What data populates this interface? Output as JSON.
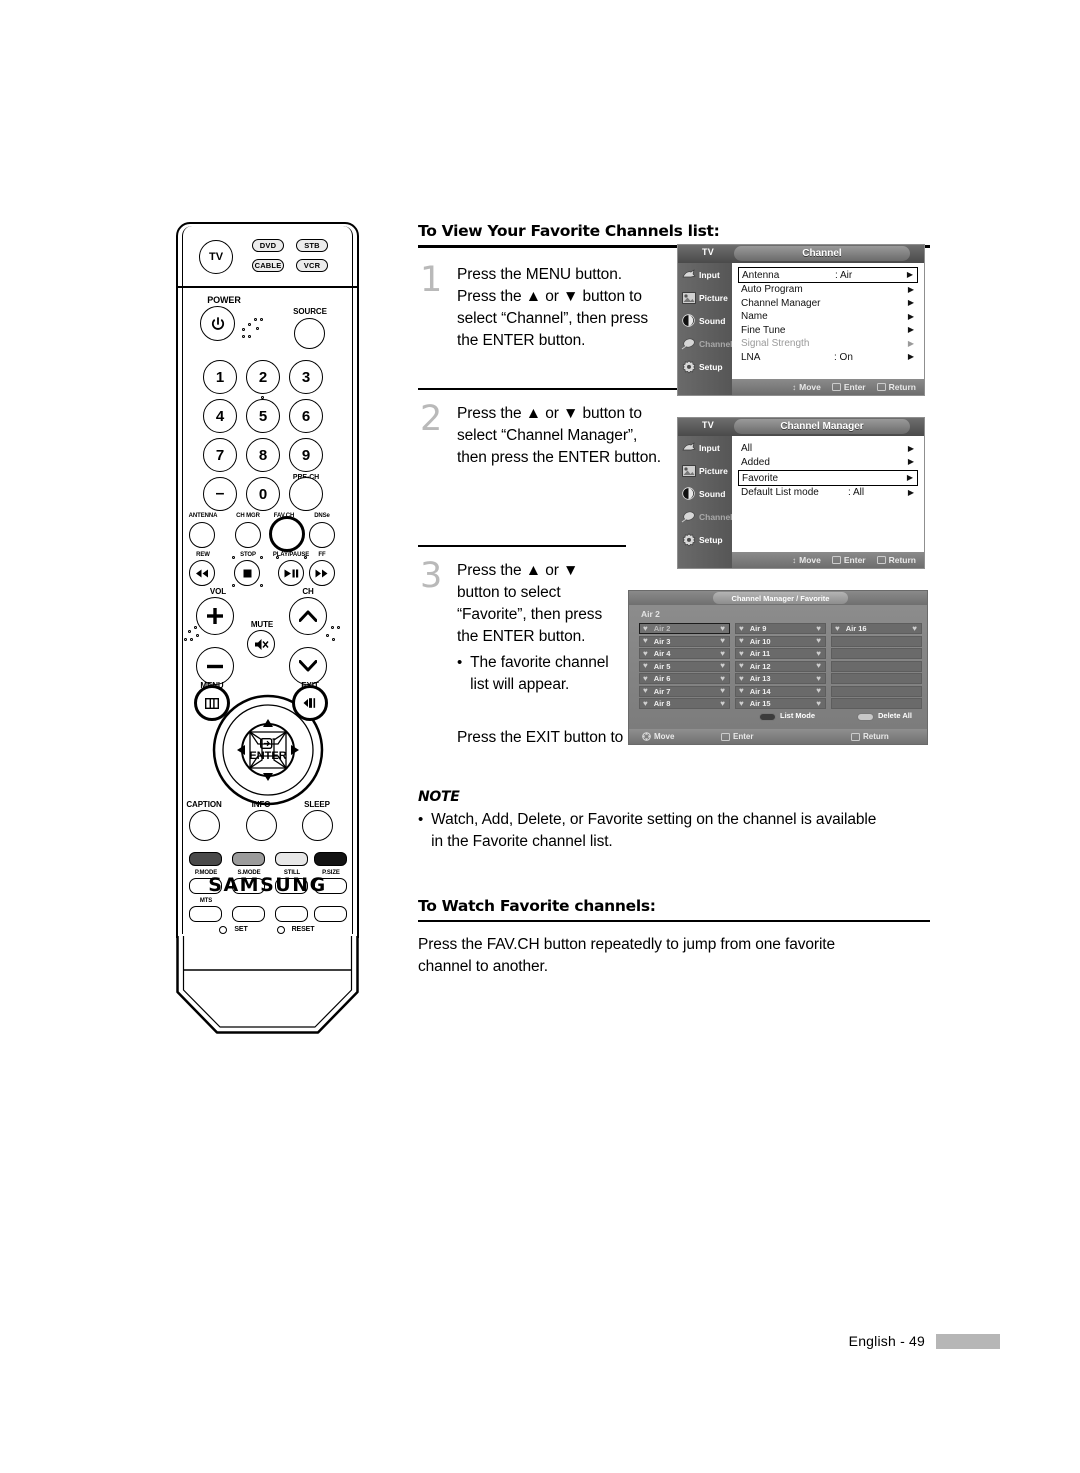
{
  "document": {
    "page_label": "English - 49"
  },
  "sections": {
    "heading1": "To View Your Favorite Channels list:",
    "heading2": "To Watch Favorite channels:",
    "note_label": "NOTE",
    "note_text": "Watch, Add, Delete, or Favorite setting on the channel is available in the Favorite channel list.",
    "exit_text": "Press the EXIT button to exit.",
    "watch_text": "Press the FAV.CH button repeatedly to jump from one favorite channel to another."
  },
  "steps": [
    {
      "number": "1",
      "lines": [
        "Press the MENU button.",
        "Press the ▲ or ▼ button to",
        "select “Channel”, then press",
        "the ENTER button."
      ]
    },
    {
      "number": "2",
      "lines": [
        "Press the ▲ or ▼ button to",
        "select “Channel Manager”,",
        "then press the ENTER button."
      ]
    },
    {
      "number": "3",
      "lines": [
        "Press the ▲ or ▼",
        "button to select",
        "“Favorite”, then press",
        "the ENTER button."
      ],
      "bullet": [
        "The favorite channel",
        "list will appear."
      ]
    }
  ],
  "osd_menu_1": {
    "tv_label": "TV",
    "title": "Channel",
    "side_items": [
      {
        "label": "Input",
        "icon": "input-icon",
        "dim": false
      },
      {
        "label": "Picture",
        "icon": "picture-icon",
        "dim": false
      },
      {
        "label": "Sound",
        "icon": "sound-icon",
        "dim": false
      },
      {
        "label": "Channel",
        "icon": "channel-icon",
        "dim": true
      },
      {
        "label": "Setup",
        "icon": "setup-icon",
        "dim": false
      }
    ],
    "rows": [
      {
        "label": "Antenna",
        "value": ": Air",
        "selected": true,
        "dim": false
      },
      {
        "label": "Auto Program",
        "value": "",
        "selected": false,
        "dim": false
      },
      {
        "label": "Channel Manager",
        "value": "",
        "selected": false,
        "dim": false
      },
      {
        "label": "Name",
        "value": "",
        "selected": false,
        "dim": false
      },
      {
        "label": "Fine Tune",
        "value": "",
        "selected": false,
        "dim": false
      },
      {
        "label": "Signal Strength",
        "value": "",
        "selected": false,
        "dim": true
      },
      {
        "label": "LNA",
        "value": ": On",
        "selected": false,
        "dim": false
      }
    ],
    "footer": {
      "move": "Move",
      "enter": "Enter",
      "return": "Return"
    }
  },
  "osd_menu_2": {
    "tv_label": "TV",
    "title": "Channel Manager",
    "side_items": [
      {
        "label": "Input",
        "icon": "input-icon",
        "dim": false
      },
      {
        "label": "Picture",
        "icon": "picture-icon",
        "dim": false
      },
      {
        "label": "Sound",
        "icon": "sound-icon",
        "dim": false
      },
      {
        "label": "Channel",
        "icon": "channel-icon",
        "dim": true
      },
      {
        "label": "Setup",
        "icon": "setup-icon",
        "dim": false
      }
    ],
    "rows": [
      {
        "label": "All",
        "value": "",
        "selected": false,
        "dim": false
      },
      {
        "label": "Added",
        "value": "",
        "selected": false,
        "dim": false
      },
      {
        "label": "Favorite",
        "value": "",
        "selected": true,
        "dim": false
      },
      {
        "label": "Default List mode",
        "value": ": All",
        "selected": false,
        "dim": false
      }
    ],
    "footer": {
      "move": "Move",
      "enter": "Enter",
      "return": "Return"
    }
  },
  "osd_menu_3": {
    "title": "Channel Manager / Favorite",
    "current_channel": "Air 2",
    "columns": [
      [
        "Air 2",
        "Air 3",
        "Air 4",
        "Air 5",
        "Air 6",
        "Air 7",
        "Air 8"
      ],
      [
        "Air 9",
        "Air 10",
        "Air 11",
        "Air 12",
        "Air 13",
        "Air 14",
        "Air 15"
      ],
      [
        "Air 16",
        "",
        "",
        "",
        "",
        "",
        ""
      ]
    ],
    "selected": {
      "column": 0,
      "row": 0
    },
    "keys": [
      {
        "label": "List Mode",
        "color": "#3c3c3c"
      },
      {
        "label": "Delete All",
        "color": "#c8c8c8"
      }
    ],
    "footer": {
      "move": "Move",
      "enter": "Enter",
      "return": "Return"
    }
  },
  "remote": {
    "brand": "SAMSUNG",
    "mode_buttons": [
      {
        "label": "TV",
        "shape": "circle"
      },
      {
        "label": "DVD",
        "shape": "rect"
      },
      {
        "label": "STB",
        "shape": "rect"
      },
      {
        "label": "CABLE",
        "shape": "rect"
      },
      {
        "label": "VCR",
        "shape": "rect"
      }
    ],
    "power_label": "POWER",
    "source_label": "SOURCE",
    "numbers": [
      "1",
      "2",
      "3",
      "4",
      "5",
      "6",
      "7",
      "8",
      "9",
      "–",
      "0"
    ],
    "pre_ch_label": "PRE-CH",
    "function_row": [
      "ANTENNA",
      "CH MGR",
      "FAV.CH",
      "DNSe"
    ],
    "transport_row": [
      "REW",
      "STOP",
      "PLAY/PAUSE",
      "FF"
    ],
    "vol_label": "VOL",
    "ch_label": "CH",
    "mute_label": "MUTE",
    "menu_label": "MENU",
    "exit_label": "EXIT",
    "enter_label": "ENTER",
    "bottom_row1": [
      "CAPTION",
      "INFO",
      "SLEEP"
    ],
    "bottom_row2": [
      "P.MODE",
      "S.MODE",
      "STILL",
      "P.SIZE"
    ],
    "bottom_row3": [
      "MTS"
    ],
    "set_label": "SET",
    "reset_label": "RESET",
    "highlighted": [
      "FAV.CH",
      "MENU",
      "EXIT"
    ]
  }
}
